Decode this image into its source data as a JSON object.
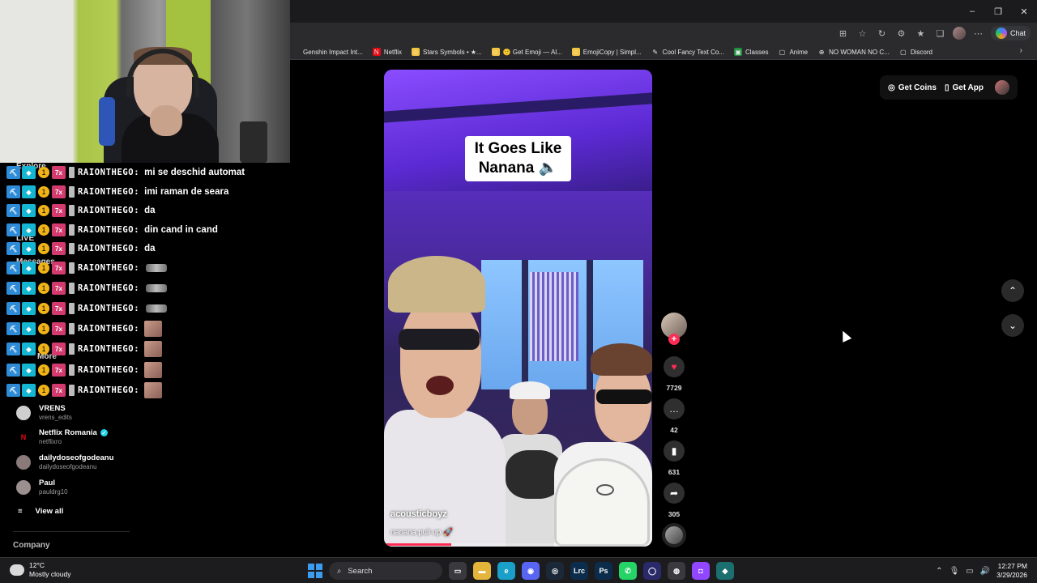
{
  "window": {
    "minimize": "–",
    "restore": "❐",
    "close": "✕"
  },
  "toolbar": {
    "chat_label": "Chat"
  },
  "bookmarks": [
    {
      "label": "Genshin Impact Int...",
      "icon": "genshin-icon",
      "color": "#2b2b2e",
      "glyph": ""
    },
    {
      "label": "Netflix",
      "icon": "netflix-icon",
      "color": "#e50914",
      "glyph": "N"
    },
    {
      "label": "Stars Symbols • ★...",
      "icon": "emoji-icon",
      "color": "#f5c542",
      "glyph": "☺"
    },
    {
      "label": "🙂 Get Emoji — Al...",
      "icon": "emoji-icon",
      "color": "#f5c542",
      "glyph": "☺"
    },
    {
      "label": "EmojiCopy | Simpl...",
      "icon": "emoji-icon",
      "color": "#f5c542",
      "glyph": "☺"
    },
    {
      "label": "Cool Fancy Text Co...",
      "icon": "pencil-icon",
      "color": "#2b2b2e",
      "glyph": "✎"
    },
    {
      "label": "Classes",
      "icon": "classroom-icon",
      "color": "#1e8e3e",
      "glyph": "▣"
    },
    {
      "label": "Anime",
      "icon": "folder-icon",
      "color": "#2b2b2e",
      "glyph": "▢"
    },
    {
      "label": "NO WOMAN NO C...",
      "icon": "globe-icon",
      "color": "#2b2b2e",
      "glyph": "⊕"
    },
    {
      "label": "Discord",
      "icon": "folder-icon",
      "color": "#2b2b2e",
      "glyph": "▢"
    }
  ],
  "sidebar": {
    "faded_items": [
      {
        "label": "Explore"
      },
      {
        "label": "LIVE"
      },
      {
        "label": "Messages"
      },
      {
        "label": "More"
      }
    ],
    "following": [
      {
        "name": "VRENS",
        "handle": "vrens_edits",
        "verified": false,
        "avatar_color": "#cfcfcf",
        "avatar_text": ""
      },
      {
        "name": "Netflix Romania",
        "handle": "netflixro",
        "verified": true,
        "avatar_color": "#000000",
        "avatar_text": "N"
      },
      {
        "name": "dailydoseofgodeanu",
        "handle": "dailydoseofgodeanu",
        "verified": false,
        "avatar_color": "#8a7a7a",
        "avatar_text": ""
      },
      {
        "name": "Paul",
        "handle": "pauldrg10",
        "verified": false,
        "avatar_color": "#9c8f8f",
        "avatar_text": ""
      }
    ],
    "view_all": "View all",
    "company": "Company"
  },
  "chat": {
    "username": "RAIONTHEGO:",
    "coin_badge": "1",
    "sub_badge": "7x",
    "messages": [
      {
        "text": "mi se deschid automat",
        "emote": "none"
      },
      {
        "text": "imi raman de seara",
        "emote": "none"
      },
      {
        "text": "da",
        "emote": "none"
      },
      {
        "text": "din cand in cand",
        "emote": "none"
      },
      {
        "text": "da",
        "emote": "none"
      },
      {
        "text": "",
        "emote": "blur"
      },
      {
        "text": "",
        "emote": "blur"
      },
      {
        "text": "",
        "emote": "blur"
      },
      {
        "text": "",
        "emote": "face"
      },
      {
        "text": "",
        "emote": "face"
      },
      {
        "text": "",
        "emote": "face"
      },
      {
        "text": "",
        "emote": "face"
      }
    ]
  },
  "video": {
    "caption": "It Goes Like\nNanana 🔈",
    "username": "acousticboyz",
    "description": "nanana pull up 🚀",
    "progress": 0.25
  },
  "actions": {
    "follow_plus": "+",
    "likes": "7729",
    "comments": "42",
    "saves": "631",
    "shares": "305",
    "like_color": "#fe2c55"
  },
  "topright": {
    "coins": "Get Coins",
    "app": "Get App"
  },
  "taskbar": {
    "temperature": "12°C",
    "weather": "Mostly cloudy",
    "search": "Search",
    "time": "12:27 PM",
    "date": "3/29/2026",
    "apps": [
      {
        "name": "task-view-icon",
        "color": "#3a3a3e",
        "glyph": "▭"
      },
      {
        "name": "file-explorer-icon",
        "color": "#e3b53a",
        "glyph": "▬"
      },
      {
        "name": "edge-icon",
        "color": "#1aa0c8",
        "glyph": "e"
      },
      {
        "name": "discord-icon",
        "color": "#5865f2",
        "glyph": "◉"
      },
      {
        "name": "steam-icon",
        "color": "#1b2838",
        "glyph": "◎"
      },
      {
        "name": "lightroom-icon",
        "color": "#0b2c4a",
        "glyph": "Lrc"
      },
      {
        "name": "photoshop-icon",
        "color": "#0b2c4a",
        "glyph": "Ps"
      },
      {
        "name": "whatsapp-icon",
        "color": "#25d366",
        "glyph": "✆"
      },
      {
        "name": "app-circle-icon",
        "color": "#2a2a6a",
        "glyph": "◯"
      },
      {
        "name": "chrome-icon",
        "color": "#3a3a3e",
        "glyph": "◍"
      },
      {
        "name": "twitch-icon",
        "color": "#9146ff",
        "glyph": "◘"
      },
      {
        "name": "app-diamond-icon",
        "color": "#1c6f6f",
        "glyph": "◆"
      }
    ]
  }
}
